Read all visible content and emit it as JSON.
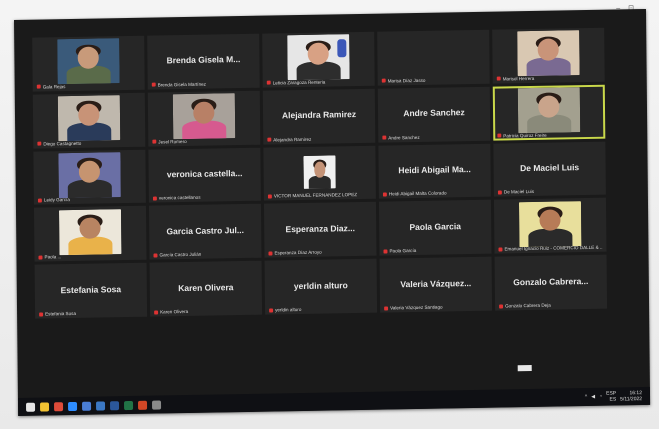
{
  "window": {
    "corner_marks": "– ⊡"
  },
  "participants": [
    {
      "label": "Gala Rejas",
      "center": "",
      "video": {
        "bg": "#3a5a7a",
        "skin": "#c89a7a",
        "shirt": "#5a6b4a"
      }
    },
    {
      "label": "Brenda Gisela Martínez",
      "center": "Brenda Gisela M...",
      "video": null
    },
    {
      "label": "Leticia Zaragoza Renteria",
      "center": "",
      "video": {
        "bg": "#e6e6e6",
        "skin": "#d8a184",
        "shirt": "#2d2d2d",
        "logo": "#3b57b8"
      }
    },
    {
      "label": "Marisa Díaz Jasso",
      "center": "",
      "video": null
    },
    {
      "label": "Marisol Herrera",
      "center": "",
      "video": {
        "bg": "#d9c8b2",
        "skin": "#c99479",
        "shirt": "#7a6a92"
      }
    },
    {
      "label": "Diego Castagnetto",
      "center": "",
      "video": {
        "bg": "#bfb8ad",
        "skin": "#c89377",
        "shirt": "#2a3b5a"
      }
    },
    {
      "label": "Jesel Romero",
      "center": "",
      "video": {
        "bg": "#a8a19a",
        "skin": "#b88066",
        "shirt": "#d65a8f"
      }
    },
    {
      "label": "Alejandra Ramírez",
      "center": "Alejandra Ramirez",
      "video": null
    },
    {
      "label": "Andre Sanchez",
      "center": "Andre Sanchez",
      "video": null
    },
    {
      "label": "Patricia Quiroz Freire",
      "center": "",
      "video": {
        "bg": "#a3a08f",
        "skin": "#c9a48b",
        "shirt": "#8a8a7a"
      },
      "active": true
    },
    {
      "label": "Leidy García",
      "center": "",
      "video": {
        "bg": "#6a6fa5",
        "skin": "#c69470",
        "shirt": "#2b2b2b"
      }
    },
    {
      "label": "veronica castellanos",
      "center": "veronica castella...",
      "video": null
    },
    {
      "label": "VICTOR MANUEL FERNANDEZ LOPEZ",
      "center": "",
      "video": {
        "bg": "#f0f0f0",
        "skin": "#c49377",
        "shirt": "#2a2a2a",
        "small": true
      }
    },
    {
      "label": "Heidi Abigail Malta Colorado",
      "center": "Heidi Abigail Ma...",
      "video": null
    },
    {
      "label": "De Maciel Luis",
      "center": "De Maciel Luis",
      "video": null
    },
    {
      "label": "Paola ...",
      "center": "",
      "video": {
        "bg": "#ece7da",
        "skin": "#b88462",
        "shirt": "#e9b24a"
      }
    },
    {
      "label": "García Castro Julián",
      "center": "Garcia Castro Jul...",
      "video": null
    },
    {
      "label": "Esperanza Díaz Arroyo",
      "center": "Esperanza Diaz...",
      "video": null
    },
    {
      "label": "Paola García",
      "center": "Paola Garcia",
      "video": null
    },
    {
      "label": "Emanuel Ignacio Ruiz - COMERCIO DALLE & ...",
      "center": "",
      "video": {
        "bg": "#e8df9c",
        "skin": "#b77b57",
        "shirt": "#2a2a2a"
      }
    },
    {
      "label": "Estefania Sosa",
      "center": "Estefania Sosa",
      "video": null
    },
    {
      "label": "Karen Olivera",
      "center": "Karen Olivera",
      "video": null
    },
    {
      "label": "yerldin alturo",
      "center": "yerldin alturo",
      "video": null
    },
    {
      "label": "Valeria Vázquez Santiago",
      "center": "Valeria Vázquez...",
      "video": null
    },
    {
      "label": "Gonzalo Cabrera Deja",
      "center": "Gonzalo Cabrera...",
      "video": null
    }
  ],
  "taskbar": {
    "icons": [
      {
        "name": "start-icon",
        "color": "#e6e6e6"
      },
      {
        "name": "explorer-icon",
        "color": "#f1c232"
      },
      {
        "name": "chrome-icon",
        "color": "#dd4b39"
      },
      {
        "name": "zoom-icon",
        "color": "#2d8cff"
      },
      {
        "name": "store-icon",
        "color": "#4a7ed6"
      },
      {
        "name": "mail-icon",
        "color": "#3b78c4"
      },
      {
        "name": "word-icon",
        "color": "#2b579a"
      },
      {
        "name": "excel-icon",
        "color": "#217346"
      },
      {
        "name": "powerpoint-icon",
        "color": "#d24726"
      },
      {
        "name": "photos-icon",
        "color": "#8a8a8a"
      }
    ],
    "lang_top": "ESP",
    "lang_bottom": "ES",
    "time": "16:12",
    "date": "5/11/2022"
  }
}
